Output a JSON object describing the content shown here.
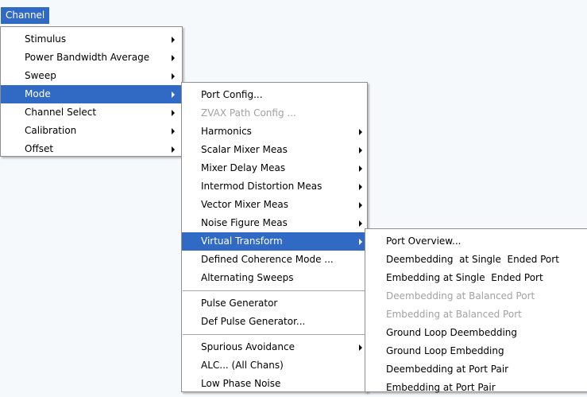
{
  "menubar": {
    "channel_label": "Channel"
  },
  "channel_menu": {
    "items": [
      {
        "label": "Stimulus"
      },
      {
        "label": "Power Bandwidth Average"
      },
      {
        "label": "Sweep"
      },
      {
        "label": "Mode"
      },
      {
        "label": "Channel Select"
      },
      {
        "label": "Calibration"
      },
      {
        "label": "Offset"
      }
    ]
  },
  "mode_menu": {
    "items": [
      {
        "label": "Port Config..."
      },
      {
        "label": "ZVAX Path Config ..."
      },
      {
        "label": "Harmonics"
      },
      {
        "label": "Scalar Mixer Meas"
      },
      {
        "label": "Mixer Delay Meas"
      },
      {
        "label": "Intermod Distortion Meas"
      },
      {
        "label": "Vector Mixer Meas"
      },
      {
        "label": "Noise Figure Meas"
      },
      {
        "label": "Virtual Transform"
      },
      {
        "label": "Defined Coherence Mode ..."
      },
      {
        "label": "Alternating Sweeps"
      },
      {
        "label": "Pulse Generator"
      },
      {
        "label": "Def Pulse Generator..."
      },
      {
        "label": "Spurious Avoidance"
      },
      {
        "label": "ALC... (All Chans)"
      },
      {
        "label": "Low Phase Noise"
      }
    ]
  },
  "virtual_transform_menu": {
    "items": [
      {
        "label": "Port Overview..."
      },
      {
        "label": "Deembedding  at Single  Ended Port"
      },
      {
        "label": "Embedding at Single  Ended Port"
      },
      {
        "label": "Deembedding at Balanced Port"
      },
      {
        "label": "Embedding at Balanced Port"
      },
      {
        "label": "Ground Loop Deembedding"
      },
      {
        "label": "Ground Loop Embedding"
      },
      {
        "label": "Deembedding at Port Pair"
      },
      {
        "label": "Embedding at Port Pair"
      }
    ]
  },
  "colors": {
    "highlight": "#316ac5",
    "disabled_text": "#a2a2a2",
    "background": "#f6f9fc"
  }
}
